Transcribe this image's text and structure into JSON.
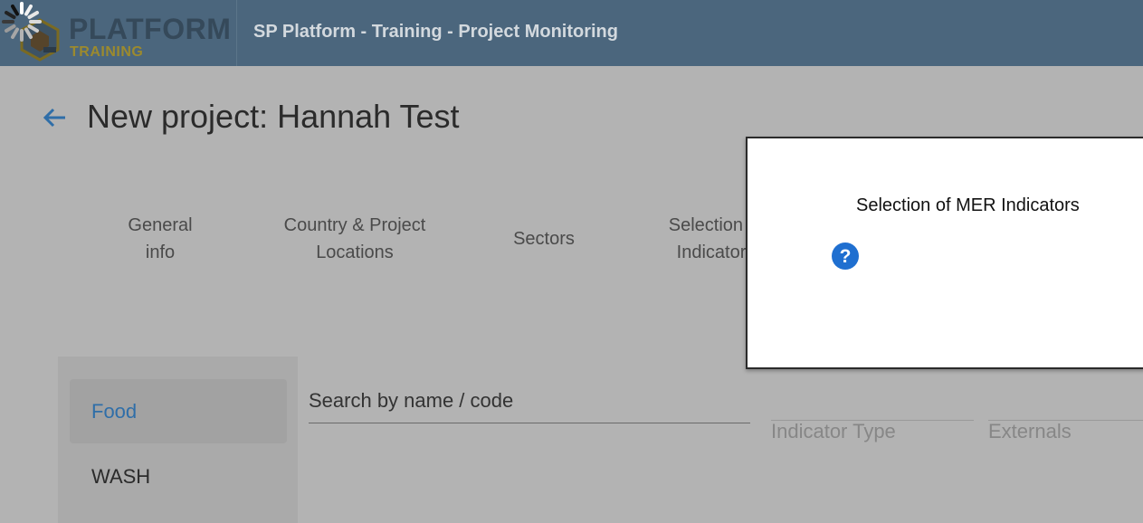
{
  "header": {
    "logo_title": "PLATFORM",
    "logo_subtitle": "TRAINING",
    "app_title": "SP Platform - Training - Project Monitoring"
  },
  "page": {
    "title": "New project: Hannah Test"
  },
  "steps": [
    {
      "label": "General\ninfo"
    },
    {
      "label": "Country & Project\nLocations"
    },
    {
      "label": "Sectors"
    },
    {
      "label": "Selection of\nIndicators"
    }
  ],
  "categories": [
    {
      "label": "Food",
      "active": true
    },
    {
      "label": "WASH",
      "active": false
    }
  ],
  "filters": {
    "search_placeholder": "Search by name / code",
    "indicator_type": "Indicator Type",
    "externals": "Externals"
  },
  "popup": {
    "title": "Selection of MER Indicators"
  },
  "colors": {
    "topbar": "#4b667d",
    "accent_blue": "#2f6ea8",
    "help_icon": "#1f6fd0",
    "logo_gold": "#9c8a2e"
  },
  "icons": {
    "loading": "spinner-icon",
    "back": "arrow-left-icon",
    "help": "question-circle-icon",
    "logo": "cube-logo-icon"
  }
}
